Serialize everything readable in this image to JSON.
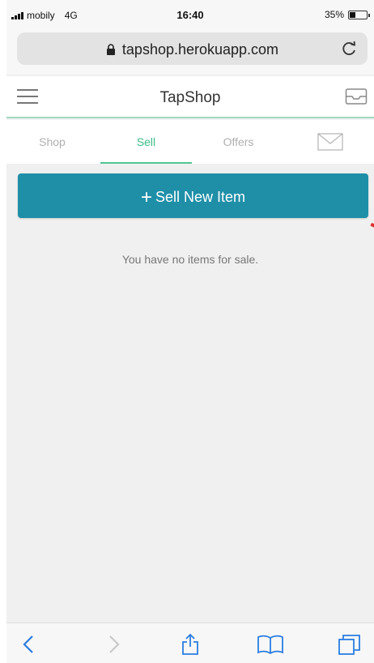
{
  "status_bar": {
    "carrier": "mobily",
    "network": "4G",
    "time": "16:40",
    "battery": "35%",
    "battery_level": 0.35
  },
  "browser": {
    "url": "tapshop.herokuapp.com"
  },
  "app": {
    "title": "TapShop"
  },
  "tabs": [
    {
      "label": "Shop",
      "active": false
    },
    {
      "label": "Sell",
      "active": true
    },
    {
      "label": "Offers",
      "active": false
    }
  ],
  "sell": {
    "button_label": "Sell New Item",
    "empty_message": "You have no items for sale."
  },
  "colors": {
    "accent": "#1f8fa8",
    "active_tab": "#3bbd86",
    "background": "#f0f0f0",
    "safari_blue": "#2a7de1"
  },
  "icons": {
    "lock": "lock-icon",
    "reload": "reload-icon",
    "menu": "hamburger-menu-icon",
    "inbox": "inbox-icon",
    "mail": "mail-icon",
    "back": "chevron-left-icon",
    "forward": "chevron-right-icon",
    "share": "share-icon",
    "bookmarks": "book-icon",
    "tabs": "tabs-icon"
  }
}
